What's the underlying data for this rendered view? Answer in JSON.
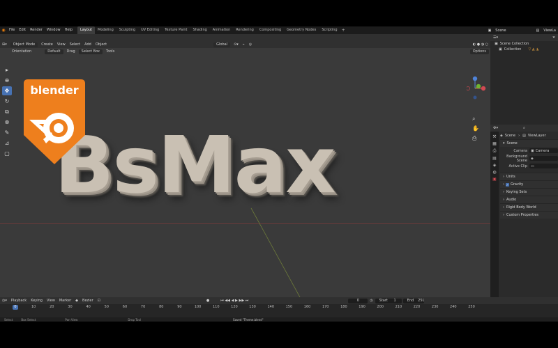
{
  "topbar": {
    "menu": [
      "File",
      "Edit",
      "Render",
      "Window",
      "Help"
    ],
    "workspaces": [
      "Layout",
      "Modeling",
      "Sculpting",
      "UV Editing",
      "Texture Paint",
      "Shading",
      "Animation",
      "Rendering",
      "Compositing",
      "Geometry Nodes",
      "Scripting"
    ],
    "active_workspace": "Layout",
    "scene_label": "Scene",
    "viewlayer_label": "ViewLa"
  },
  "viewport_header": {
    "mode": "Object Mode",
    "menus": [
      "View",
      "Select",
      "Add",
      "Object"
    ],
    "create": "Create",
    "transform": "Global",
    "options": "Options"
  },
  "viewport_header2": {
    "orientation_label": "Orientation",
    "orientation_value": "Default",
    "drag_label": "Drag",
    "drag_value": "Select Box",
    "tools_label": "Tools"
  },
  "overlay": {
    "logo_text": "blender",
    "title_text": "BsMax"
  },
  "outliner": {
    "rows": [
      "Scene Collection",
      "Collection"
    ]
  },
  "properties": {
    "breadcrumb_scene": "Scene",
    "breadcrumb_viewlayer": "ViewLayer",
    "section_scene": "Scene",
    "camera_label": "Camera",
    "camera_value": "Camera",
    "bg_label": "Background Scene",
    "clip_label": "Active Clip",
    "sections": [
      "Units",
      "Gravity",
      "Keying Sets",
      "Audio",
      "Rigid Body World",
      "Custom Properties"
    ]
  },
  "timeline": {
    "menus": [
      "Playback",
      "Keying",
      "View",
      "Marker"
    ],
    "interp": "Bezier",
    "current_frame": "0",
    "start_label": "Start",
    "start_value": "1",
    "end_label": "End",
    "end_value": "250",
    "ticks": [
      "0",
      "10",
      "20",
      "30",
      "40",
      "50",
      "60",
      "70",
      "80",
      "90",
      "100",
      "110",
      "120",
      "130",
      "140",
      "150",
      "160",
      "170",
      "180",
      "190",
      "200",
      "210",
      "220",
      "230",
      "240",
      "250"
    ]
  },
  "statusbar": {
    "items": [
      "Select",
      "Box Select",
      "Pan View",
      "Drop Tool"
    ],
    "message": "Saved \"Theme.blend\""
  },
  "colors": {
    "accent": "#4772b3",
    "brand": "#e87d0d"
  }
}
